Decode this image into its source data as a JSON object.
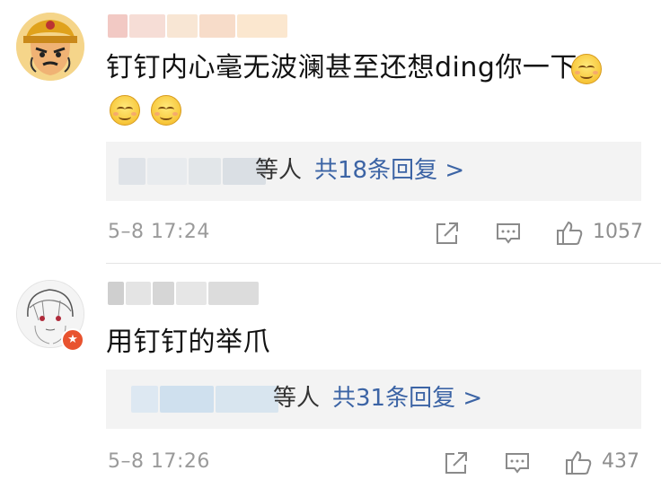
{
  "comments": [
    {
      "text": "钉钉内心毫无波澜甚至还想ding你一下",
      "reply_suffix": "等人",
      "reply_count": "共18条回复 >",
      "timestamp": "5–8 17:24",
      "likes": "1057",
      "emojis": [
        "smile-emoji",
        "smile-emoji",
        "smile-emoji"
      ]
    },
    {
      "text": "用钉钉的举爪",
      "reply_suffix": "等人",
      "reply_count": "共31条回复 >",
      "timestamp": "5–8 17:26",
      "likes": "437",
      "badge": "★"
    }
  ],
  "colors": {
    "link_blue": "#3c64a5",
    "meta_gray": "#9a9a9a",
    "reply_bg": "#f3f3f3",
    "verified_badge": "#e8532f"
  },
  "icons": [
    "share-icon",
    "comment-icon",
    "thumbs-up-icon"
  ]
}
